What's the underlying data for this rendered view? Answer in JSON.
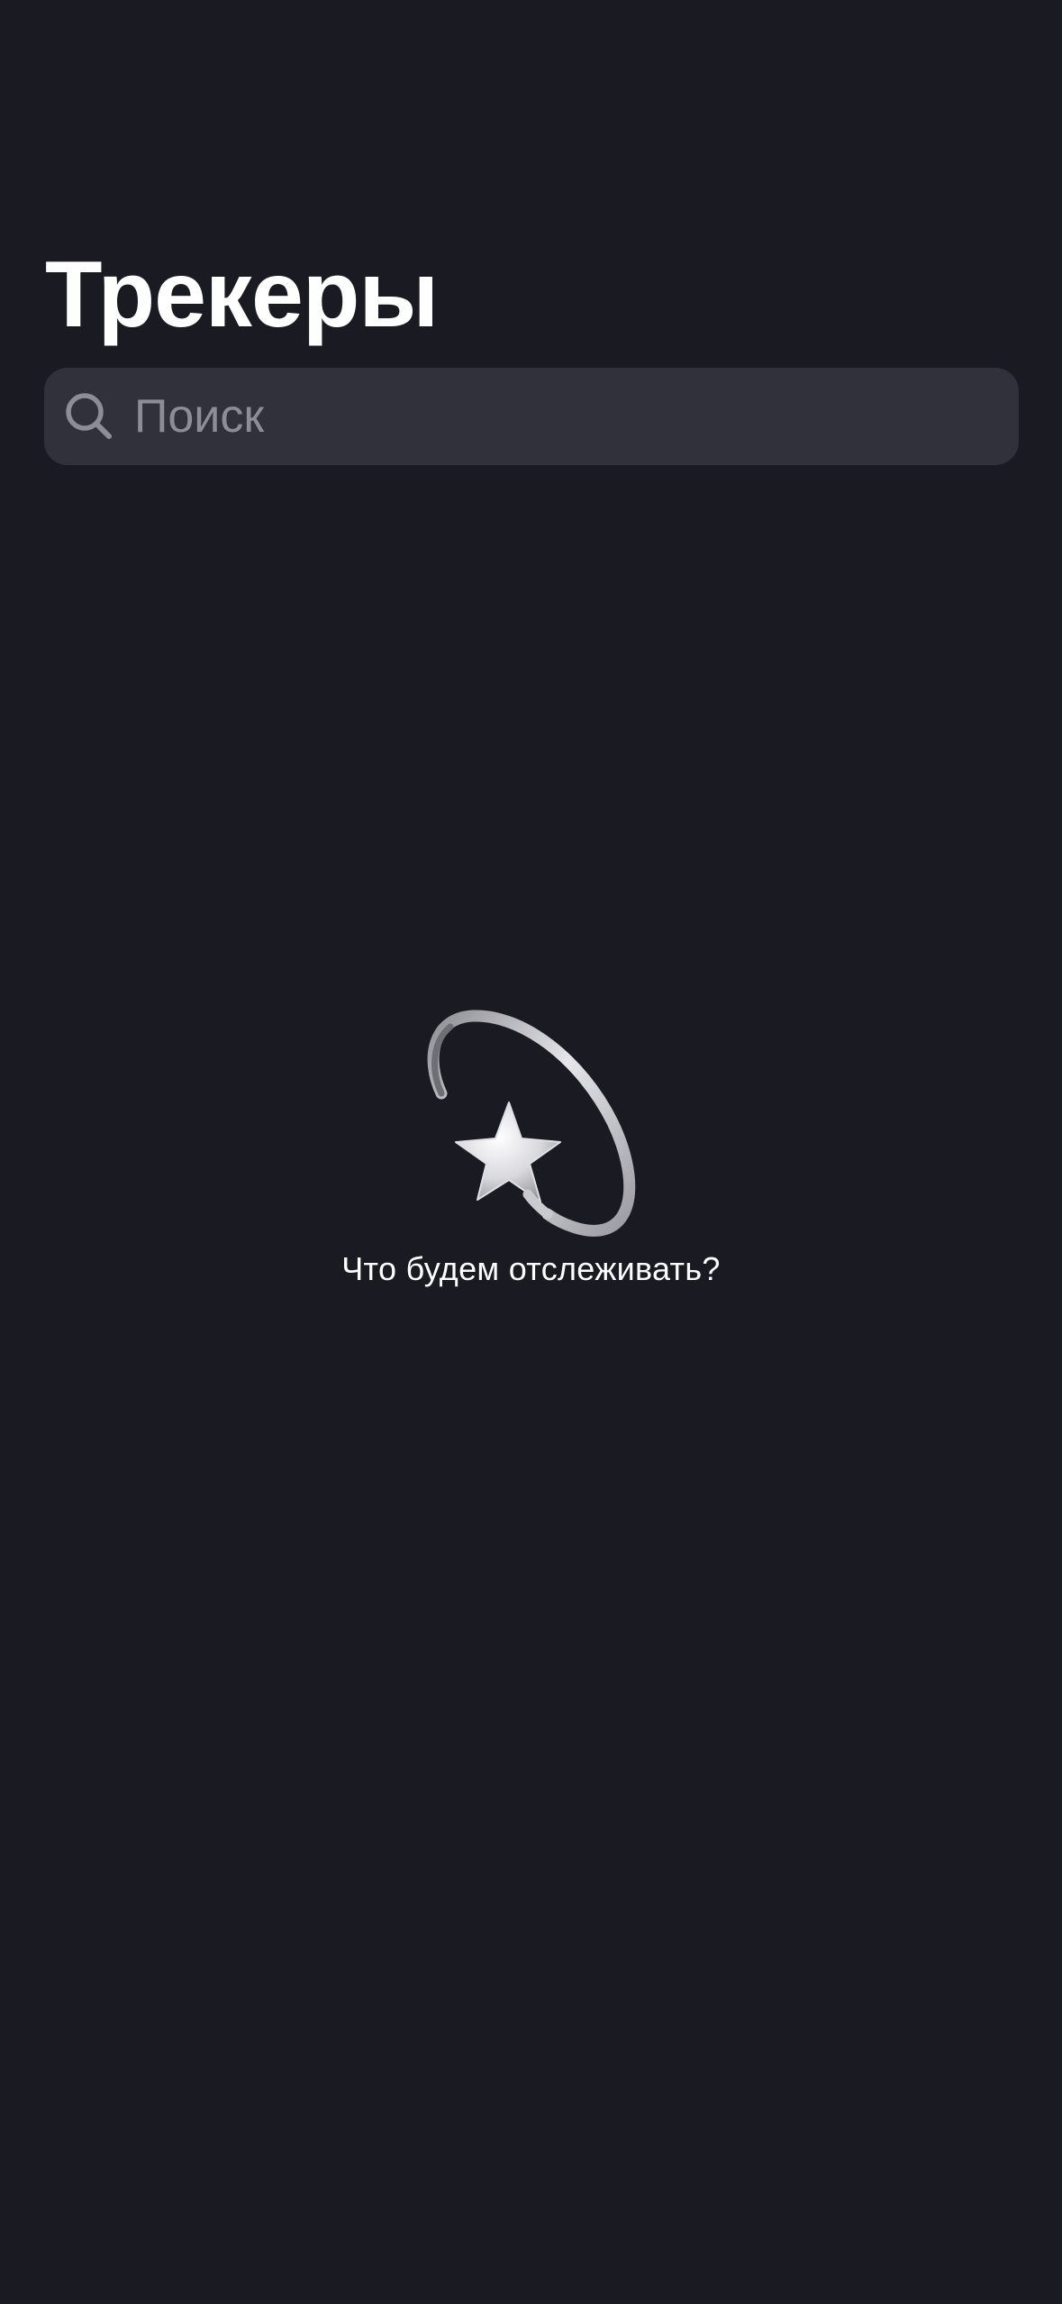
{
  "header": {
    "title": "Трекеры"
  },
  "search": {
    "placeholder": "Поиск",
    "value": "",
    "icon": "search-icon"
  },
  "empty_state": {
    "icon": "dizzy-star-icon",
    "message": "Что будем отслеживать?"
  },
  "colors": {
    "background": "#1A1B22",
    "search_field": "#31313B",
    "placeholder": "#8D8D96",
    "text": "#FFFFFF"
  }
}
